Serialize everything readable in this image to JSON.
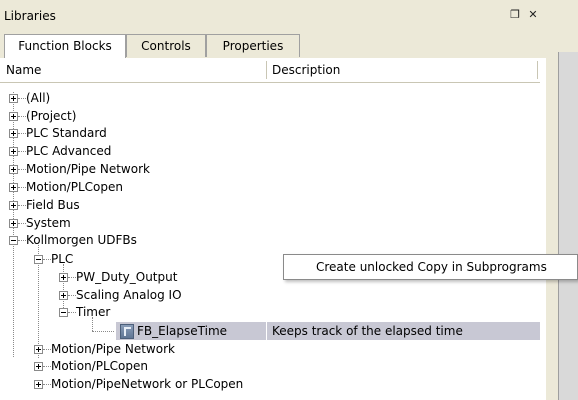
{
  "window": {
    "title": "Libraries",
    "float_icon": "float-icon",
    "close_icon": "close-icon"
  },
  "tabs": [
    {
      "label": "Function Blocks",
      "active": true
    },
    {
      "label": "Controls",
      "active": false
    },
    {
      "label": "Properties",
      "active": false
    }
  ],
  "columns": {
    "name": "Name",
    "description": "Description"
  },
  "tree": {
    "top_level": [
      {
        "label": "(All)",
        "state": "collapsed"
      },
      {
        "label": "(Project)",
        "state": "collapsed"
      },
      {
        "label": "PLC Standard",
        "state": "collapsed"
      },
      {
        "label": "PLC Advanced",
        "state": "collapsed"
      },
      {
        "label": "Motion/Pipe Network",
        "state": "collapsed"
      },
      {
        "label": "Motion/PLCopen",
        "state": "collapsed"
      },
      {
        "label": "Field Bus",
        "state": "collapsed"
      },
      {
        "label": "System",
        "state": "collapsed"
      },
      {
        "label": "Kollmorgen UDFBs",
        "state": "expanded"
      }
    ],
    "kollmorgen": {
      "plc": {
        "label": "PLC",
        "state": "expanded"
      },
      "plc_children": [
        {
          "label": "PW_Duty_Output",
          "state": "collapsed"
        },
        {
          "label": "Scaling Analog IO",
          "state": "collapsed"
        },
        {
          "label": "Timer",
          "state": "expanded"
        }
      ],
      "timer_child": {
        "label": "FB_ElapseTime",
        "description": "Keeps track of the elapsed time"
      },
      "siblings": [
        {
          "label": "Motion/Pipe Network",
          "state": "collapsed"
        },
        {
          "label": "Motion/PLCopen",
          "state": "collapsed"
        },
        {
          "label": "Motion/PipeNetwork or PLCopen",
          "state": "collapsed"
        }
      ]
    }
  },
  "context_menu": {
    "items": [
      {
        "label": "Create unlocked Copy in Subprograms"
      }
    ]
  }
}
